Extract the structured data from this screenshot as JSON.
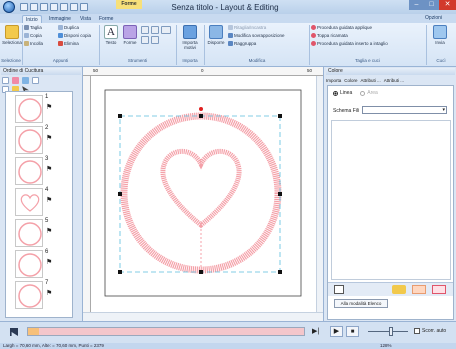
{
  "title": "Senza titolo - Layout & Editing",
  "context_tab": "Forme",
  "tabs": [
    "Inizio",
    "Immagine",
    "Vista",
    "Forme"
  ],
  "options_label": "Opzioni",
  "ribbon": {
    "selection": {
      "button": "Seleziona",
      "label": "Selezione"
    },
    "clipboard": {
      "items": [
        "Taglia",
        "Copia",
        "Incolla"
      ],
      "items2": [
        "Duplica",
        "Disponi copia",
        "Elimina"
      ],
      "label": "Appunti"
    },
    "tools": {
      "text_label": "Testo",
      "shapes_label": "Forme",
      "label": "Strumenti"
    },
    "import": {
      "button_lines": [
        "Importa",
        "motivi"
      ],
      "label": "Importa"
    },
    "modify": {
      "dispose_label": "Disporre",
      "items": [
        "Ritaglia/Incastra",
        "Modifica sovrapposizione",
        "Raggruppa"
      ],
      "label": "Modifica"
    },
    "applique": {
      "items": [
        "Procedura guidata applique",
        "Toppa ricamata",
        "Procedura guidata inserto a intaglio"
      ],
      "label": "Taglia e cuci"
    },
    "send": {
      "button": "Invia",
      "label": "Cucì"
    }
  },
  "left_panel": {
    "title": "Ordine di Cucitura",
    "items": [
      {
        "num": "1",
        "shape": "circle"
      },
      {
        "num": "2",
        "shape": "circle"
      },
      {
        "num": "3",
        "shape": "circle"
      },
      {
        "num": "4",
        "shape": "heart"
      },
      {
        "num": "5",
        "shape": "circle"
      },
      {
        "num": "6",
        "shape": "circle"
      },
      {
        "num": "7",
        "shape": "circle"
      }
    ]
  },
  "ruler": {
    "marks": [
      "50",
      "0",
      "50"
    ]
  },
  "right_panel": {
    "title": "Colore",
    "tabs": [
      "Importa",
      "Colore",
      "Attributi ...",
      "Attributi ..."
    ],
    "radio_selected": "Linea",
    "radio_other": "Area",
    "schema_label": "Schema Fili",
    "list_mode_button": "Alla modalità Elenco"
  },
  "bottom": {
    "checkbox_label": "Scorr. auto"
  },
  "status": {
    "text": "Largh = 70,60 mm, Alte: = 70,60 mm, Punti = 2379",
    "zoom": "128%"
  },
  "colors": {
    "accent": "#1f5fb0",
    "stitch": "#f4a0a8",
    "selection": "#5bbfde"
  }
}
